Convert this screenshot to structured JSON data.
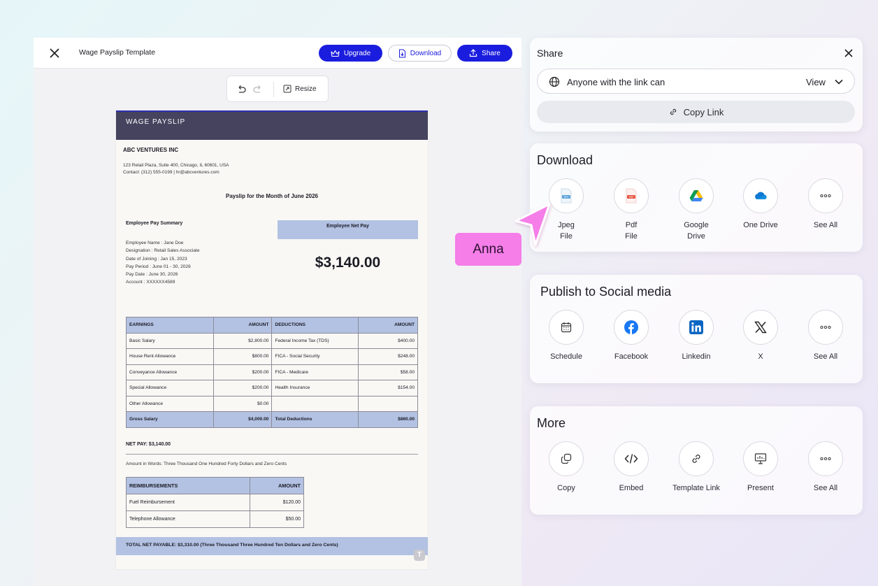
{
  "editor": {
    "title": "Wage Payslip Template",
    "upgrade_label": "Upgrade",
    "download_label": "Download",
    "share_label": "Share",
    "resize_label": "Resize"
  },
  "payslip": {
    "header": "WAGE PAYSLIP",
    "company": "ABC VENTURES INC",
    "address_line1": "123 Retail Plaza, Suite 400, Chicago, IL 60601, USA",
    "address_line2": "Contact: (312) 555-0199 | hr@abcventures.com",
    "month_title": "Payslip for the Month of June 2026",
    "summary_title": "Employee Pay Summary",
    "employee_lines": [
      "Employee Name : Jane Doe",
      "Designation : Retail Sales Associate",
      "Date of Joining : Jan 15, 2023",
      "Pay Period : June 01 - 30, 2026",
      "Pay Date : June 30, 2026",
      "Account : XXXXXX4589"
    ],
    "net_pay_box_label": "Employee Net Pay",
    "net_pay_amount": "$3,140.00",
    "earnings_headers": [
      "EARNINGS",
      "AMOUNT",
      "DEDUCTIONS",
      "AMOUNT"
    ],
    "earnings_rows": [
      [
        "Basic Salary",
        "$2,800.00",
        "Federal Income Tax (TDS)",
        "$400.00"
      ],
      [
        "House Rent Allowance",
        "$800.00",
        "FICA - Social Security",
        "$248.00"
      ],
      [
        "Conveyance Allowance",
        "$200.00",
        "FICA - Medicare",
        "$58.00"
      ],
      [
        "Special Allowance",
        "$200.00",
        "Health Insurance",
        "$154.00"
      ],
      [
        "Other Allowance",
        "$0.00",
        "",
        ""
      ]
    ],
    "earnings_total": [
      "Gross Salary",
      "$4,000.00",
      "Total Deductions",
      "$860.00"
    ],
    "net_pay_line": "NET PAY:  $3,140.00",
    "amount_in_words": "Amount in Words: Three Thousand One Hundred Forty Dollars and Zero Cents",
    "reimb_headers": [
      "REIMBURSEMENTS",
      "AMOUNT"
    ],
    "reimb_rows": [
      [
        "Fuel Reimbursement",
        "$120.00"
      ],
      [
        "Telephone Allowance",
        "$50.00"
      ]
    ],
    "total_net_payable": "TOTAL NET PAYABLE:  $3,310.00  (Three Thousand Three Hundred Ten Dollars and Zero Cents)",
    "badge": "T"
  },
  "share": {
    "title": "Share",
    "link_access_label": "Anyone with the link can",
    "link_access_value": "View",
    "copy_link_label": "Copy Link"
  },
  "download": {
    "title": "Download",
    "options": [
      {
        "line1": "Jpeg",
        "line2": "File",
        "icon": "jpeg-file-icon"
      },
      {
        "line1": "Pdf",
        "line2": "File",
        "icon": "pdf-file-icon"
      },
      {
        "line1": "Google",
        "line2": "Drive",
        "icon": "google-drive-icon"
      },
      {
        "line1": "One Drive",
        "line2": "",
        "icon": "onedrive-icon"
      },
      {
        "line1": "See All",
        "line2": "",
        "icon": "more-dots-icon"
      }
    ]
  },
  "social": {
    "title": "Publish to Social media",
    "options": [
      {
        "label": "Schedule",
        "icon": "calendar-icon"
      },
      {
        "label": "Facebook",
        "icon": "facebook-icon"
      },
      {
        "label": "Linkedin",
        "icon": "linkedin-icon"
      },
      {
        "label": "X",
        "icon": "x-icon"
      },
      {
        "label": "See All",
        "icon": "more-dots-icon"
      }
    ]
  },
  "more": {
    "title": "More",
    "options": [
      {
        "label": "Copy",
        "icon": "copy-icon"
      },
      {
        "label": "Embed",
        "icon": "code-icon"
      },
      {
        "label": "Template Link",
        "icon": "link-icon"
      },
      {
        "label": "Present",
        "icon": "presentation-icon"
      },
      {
        "label": "See All",
        "icon": "more-dots-icon"
      }
    ]
  },
  "collaborator": {
    "name": "Anna",
    "color": "#f57ee8"
  },
  "colors": {
    "accent": "#1b1dde",
    "payslip_header": "#45435e",
    "table_header": "#b3c2e3"
  }
}
